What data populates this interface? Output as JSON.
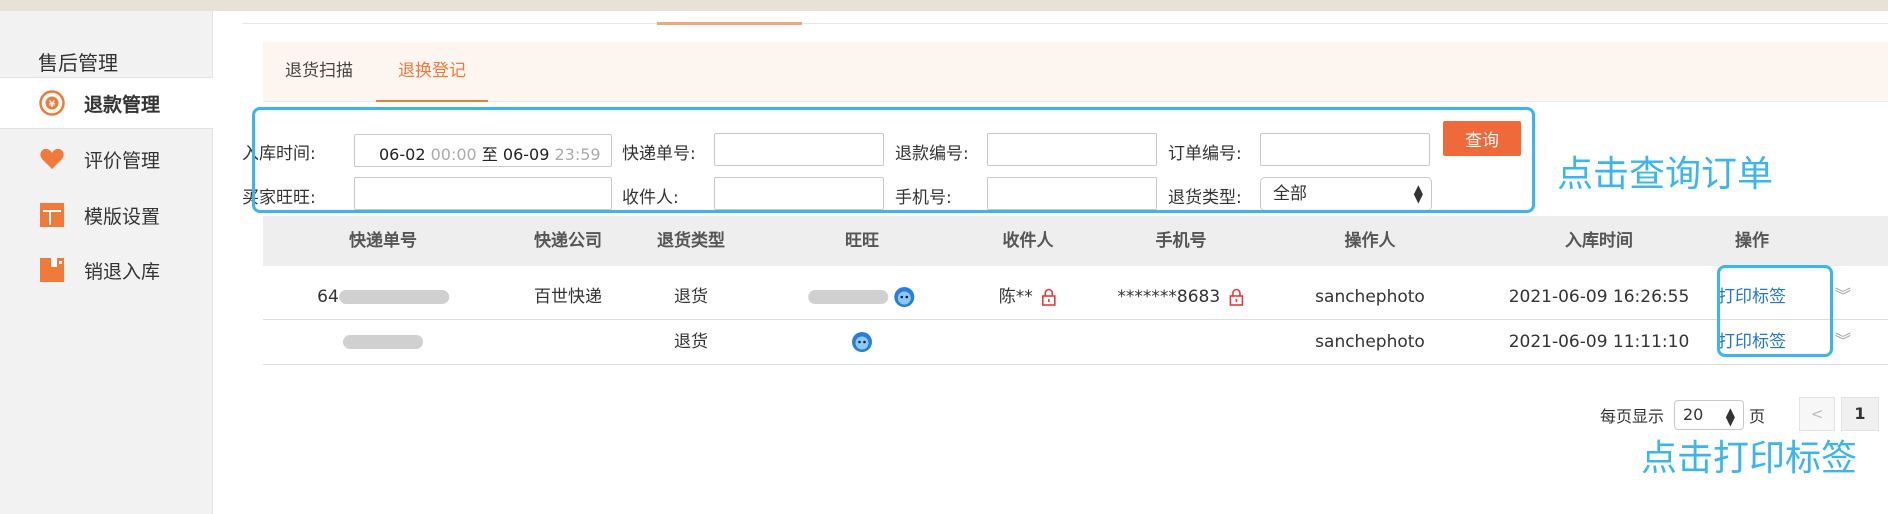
{
  "sidebar": {
    "title": "售后管理",
    "items": [
      {
        "label": "退款管理",
        "icon": "refund-coin-icon",
        "active": true
      },
      {
        "label": "评价管理",
        "icon": "heart-icon",
        "active": false
      },
      {
        "label": "模版设置",
        "icon": "template-layout-icon",
        "active": false
      },
      {
        "label": "销退入库",
        "icon": "return-stock-icon",
        "active": false
      }
    ]
  },
  "tabs": [
    {
      "label": "退货扫描",
      "active": false
    },
    {
      "label": "退换登记",
      "active": true
    }
  ],
  "filters": {
    "inbound_time_label": "入库时间:",
    "date_from": "06-02",
    "time_from": "00:00",
    "date_sep": "至",
    "date_to": "06-09",
    "time_to": "23:59",
    "tracking_no_label": "快递单号:",
    "refund_no_label": "退款编号:",
    "order_no_label": "订单编号:",
    "query_button": "查询",
    "buyer_label": "买家旺旺:",
    "receiver_label": "收件人:",
    "phone_label": "手机号:",
    "return_type_label": "退货类型:",
    "return_type_value": "全部"
  },
  "table": {
    "headers": [
      "快递单号",
      "快递公司",
      "退货类型",
      "旺旺",
      "收件人",
      "手机号",
      "操作人",
      "入库时间",
      "操作"
    ],
    "rows": [
      {
        "tracking": "64",
        "company": "百世快递",
        "type": "退货",
        "receiver": "陈**",
        "phone": "*******8683",
        "operator": "sanchephoto",
        "time": "2021-06-09 16:26:55",
        "action": "打印标签"
      },
      {
        "tracking": "",
        "company": "",
        "type": "退货",
        "receiver": "",
        "phone": "",
        "operator": "sanchephoto",
        "time": "2021-06-09 11:11:10",
        "action": "打印标签"
      }
    ]
  },
  "pagination": {
    "per_page_label": "每页显示",
    "per_page_value": "20",
    "page_unit": "页",
    "prev": "<",
    "current_page": "1"
  },
  "annotations": {
    "query_hint": "点击查询订单",
    "print_hint": "点击打印标签"
  },
  "colors": {
    "accent_orange": "#f07a3a",
    "query_button": "#ee6a3a",
    "annotation_blue": "#3bb5ec",
    "link_blue": "#2476d2"
  }
}
